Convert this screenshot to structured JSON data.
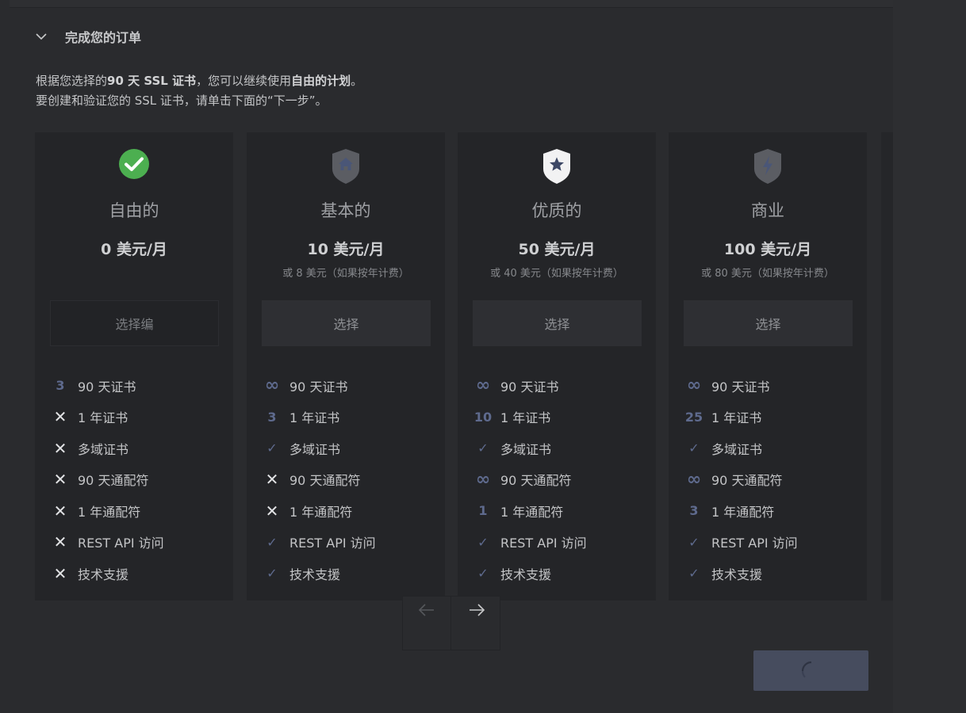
{
  "section": {
    "title": "完成您的订单"
  },
  "intro": {
    "line1_prefix": "根据您选择的",
    "line1_cert": "90 天 SSL 证书",
    "line1_middle": "，您可以继续使用",
    "line1_plan": "自由的计划",
    "line1_suffix": "。",
    "line2": "要创建和验证您的 SSL 证书，请单击下面的“下一步”。"
  },
  "plans": [
    {
      "name": "自由的",
      "icon": "check-circle-icon",
      "price": "0 美元/月",
      "annual": "",
      "button": "选择编",
      "selected": true,
      "features": [
        {
          "mark": "3",
          "label": "90 天证书"
        },
        {
          "mark": "✕",
          "label": "1 年证书"
        },
        {
          "mark": "✕",
          "label": "多域证书"
        },
        {
          "mark": "✕",
          "label": "90 天通配符"
        },
        {
          "mark": "✕",
          "label": "1 年通配符"
        },
        {
          "mark": "✕",
          "label": "REST API 访问"
        },
        {
          "mark": "✕",
          "label": "技术支援"
        }
      ]
    },
    {
      "name": "基本的",
      "icon": "shield-home-icon",
      "price": "10 美元/月",
      "annual": "或 8 美元（如果按年计费）",
      "button": "选择",
      "selected": false,
      "features": [
        {
          "mark": "∞",
          "label": "90 天证书"
        },
        {
          "mark": "3",
          "label": "1 年证书"
        },
        {
          "mark": "✓",
          "label": "多域证书"
        },
        {
          "mark": "✕",
          "label": "90 天通配符"
        },
        {
          "mark": "✕",
          "label": "1 年通配符"
        },
        {
          "mark": "✓",
          "label": "REST API 访问"
        },
        {
          "mark": "✓",
          "label": "技术支援"
        }
      ]
    },
    {
      "name": "优质的",
      "icon": "shield-star-icon",
      "price": "50 美元/月",
      "annual": "或 40 美元（如果按年计费）",
      "button": "选择",
      "selected": false,
      "features": [
        {
          "mark": "∞",
          "label": "90 天证书"
        },
        {
          "mark": "10",
          "label": "1 年证书"
        },
        {
          "mark": "✓",
          "label": "多域证书"
        },
        {
          "mark": "∞",
          "label": "90 天通配符"
        },
        {
          "mark": "1",
          "label": "1 年通配符"
        },
        {
          "mark": "✓",
          "label": "REST API 访问"
        },
        {
          "mark": "✓",
          "label": "技术支援"
        }
      ]
    },
    {
      "name": "商业",
      "icon": "shield-bolt-icon",
      "price": "100 美元/月",
      "annual": "或 80 美元（如果按年计费）",
      "button": "选择",
      "selected": false,
      "features": [
        {
          "mark": "∞",
          "label": "90 天证书"
        },
        {
          "mark": "25",
          "label": "1 年证书"
        },
        {
          "mark": "✓",
          "label": "多域证书"
        },
        {
          "mark": "∞",
          "label": "90 天通配符"
        },
        {
          "mark": "3",
          "label": "1 年通配符"
        },
        {
          "mark": "✓",
          "label": "REST API 访问"
        },
        {
          "mark": "✓",
          "label": "技术支援"
        }
      ]
    }
  ],
  "pager": {
    "prev_icon": "arrow-left-icon",
    "next_icon": "arrow-right-icon"
  },
  "next_button": {
    "state": "loading",
    "icon": "spinner-icon"
  },
  "colors": {
    "background": "#2a2b2e",
    "card": "#242528",
    "accent_muted": "#5e6a8d",
    "success": "#4caf50",
    "next_button": "#464c5e"
  }
}
